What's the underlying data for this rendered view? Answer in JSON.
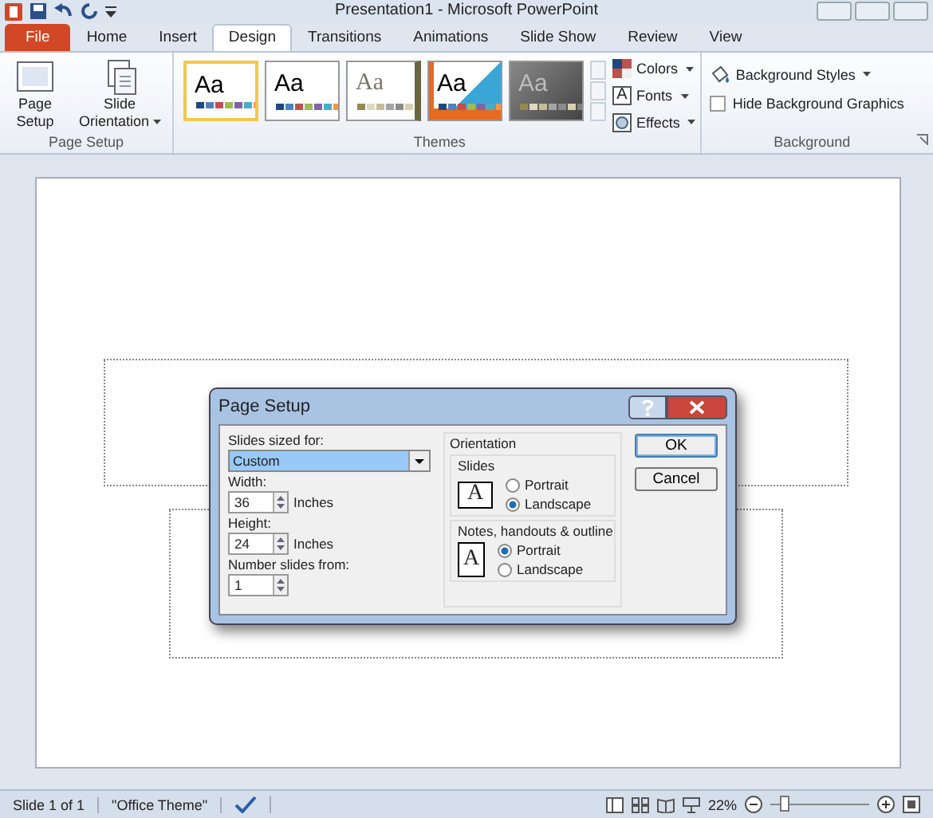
{
  "window": {
    "title": "Presentation1  -  Microsoft PowerPoint"
  },
  "tabs": [
    {
      "label": "File",
      "kind": "file",
      "selected": false
    },
    {
      "label": "Home",
      "kind": "tab",
      "selected": false
    },
    {
      "label": "Insert",
      "kind": "tab",
      "selected": false
    },
    {
      "label": "Design",
      "kind": "tab",
      "selected": true
    },
    {
      "label": "Transitions",
      "kind": "tab",
      "selected": false
    },
    {
      "label": "Animations",
      "kind": "tab",
      "selected": false
    },
    {
      "label": "Slide Show",
      "kind": "tab",
      "selected": false
    },
    {
      "label": "Review",
      "kind": "tab",
      "selected": false
    },
    {
      "label": "View",
      "kind": "tab",
      "selected": false
    }
  ],
  "page_setup_group": {
    "label": "Page Setup",
    "buttons": [
      {
        "label": "Page Setup",
        "kind": "page",
        "dropdown": false
      },
      {
        "label": "Slide Orientation",
        "kind": "orientation",
        "dropdown": true
      }
    ]
  },
  "themes_group": {
    "label": "Themes",
    "themes": [
      {
        "kind": "office",
        "sample": "Aa",
        "selected": true
      },
      {
        "kind": "plain",
        "sample": "Aa",
        "selected": false
      },
      {
        "kind": "earth",
        "sample": "Aa",
        "selected": false
      },
      {
        "kind": "diagonal",
        "sample": "Aa",
        "selected": false
      },
      {
        "kind": "dark",
        "sample": "Aa",
        "selected": false
      }
    ],
    "options": [
      {
        "label": "Colors",
        "kind": "colors"
      },
      {
        "label": "Fonts",
        "kind": "fonts",
        "icon_letter": "A"
      },
      {
        "label": "Effects",
        "kind": "effects"
      }
    ]
  },
  "background_group": {
    "label": "Background",
    "styles_button": "Background Styles",
    "hide_graphics": {
      "label": "Hide Background Graphics",
      "checked": false
    }
  },
  "dialog": {
    "title": "Page Setup",
    "sized_for_label": "Slides sized for:",
    "sized_for_value": "Custom",
    "width_label": "Width:",
    "width_value": "36",
    "width_unit": "Inches",
    "height_label": "Height:",
    "height_value": "24",
    "height_unit": "Inches",
    "number_label": "Number slides from:",
    "number_value": "1",
    "orientation_label": "Orientation",
    "sections": [
      {
        "label": "Slides",
        "kind": "landscape",
        "page_letter": "A",
        "options": [
          {
            "label": "Portrait",
            "selected": false
          },
          {
            "label": "Landscape",
            "selected": true
          }
        ]
      },
      {
        "label": "Notes, handouts & outline",
        "kind": "portrait",
        "page_letter": "A",
        "options": [
          {
            "label": "Portrait",
            "selected": true
          },
          {
            "label": "Landscape",
            "selected": false
          }
        ]
      }
    ],
    "buttons": [
      "OK",
      "Cancel"
    ]
  },
  "status_bar": {
    "slide": "Slide 1 of 1",
    "theme": "\"Office Theme\"",
    "zoom": "22%",
    "zoom_slider": {
      "level": 0.1
    }
  }
}
